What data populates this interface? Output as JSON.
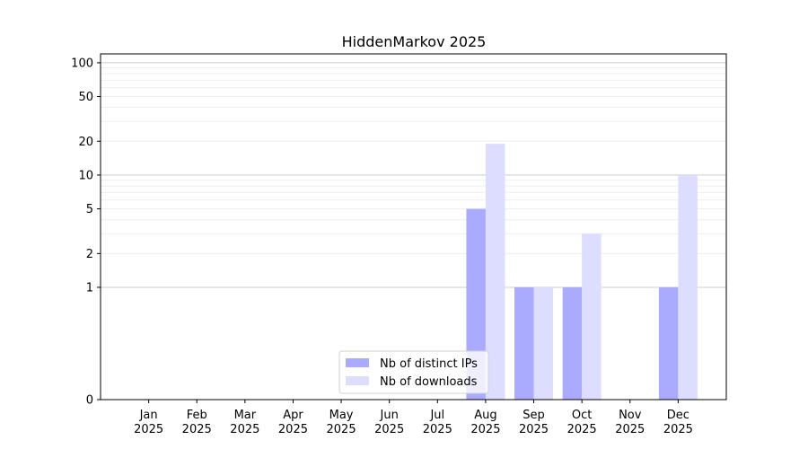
{
  "chart_data": {
    "type": "bar",
    "title": "HiddenMarkov 2025",
    "xlabel": "",
    "ylabel": "",
    "y_scale": "symlog",
    "ylim": [
      0,
      120
    ],
    "y_ticks": [
      {
        "value": 0,
        "label": "0"
      },
      {
        "value": 1,
        "label": "1"
      },
      {
        "value": 2,
        "label": "2"
      },
      {
        "value": 5,
        "label": "5"
      },
      {
        "value": 10,
        "label": "10"
      },
      {
        "value": 20,
        "label": "20"
      },
      {
        "value": 50,
        "label": "50"
      },
      {
        "value": 100,
        "label": "100"
      }
    ],
    "grid": true,
    "categories": [
      {
        "month": "Jan",
        "year": "2025"
      },
      {
        "month": "Feb",
        "year": "2025"
      },
      {
        "month": "Mar",
        "year": "2025"
      },
      {
        "month": "Apr",
        "year": "2025"
      },
      {
        "month": "May",
        "year": "2025"
      },
      {
        "month": "Jun",
        "year": "2025"
      },
      {
        "month": "Jul",
        "year": "2025"
      },
      {
        "month": "Aug",
        "year": "2025"
      },
      {
        "month": "Sep",
        "year": "2025"
      },
      {
        "month": "Oct",
        "year": "2025"
      },
      {
        "month": "Nov",
        "year": "2025"
      },
      {
        "month": "Dec",
        "year": "2025"
      }
    ],
    "series": [
      {
        "name": "Nb of distinct IPs",
        "color": "#aaaaff",
        "values": [
          0,
          0,
          0,
          0,
          0,
          0,
          0,
          5,
          1,
          1,
          0,
          1
        ]
      },
      {
        "name": "Nb of downloads",
        "color": "#ddddff",
        "values": [
          0,
          0,
          0,
          0,
          0,
          0,
          0,
          19,
          1,
          3,
          0,
          10
        ]
      }
    ],
    "legend_position": "lower-center"
  }
}
